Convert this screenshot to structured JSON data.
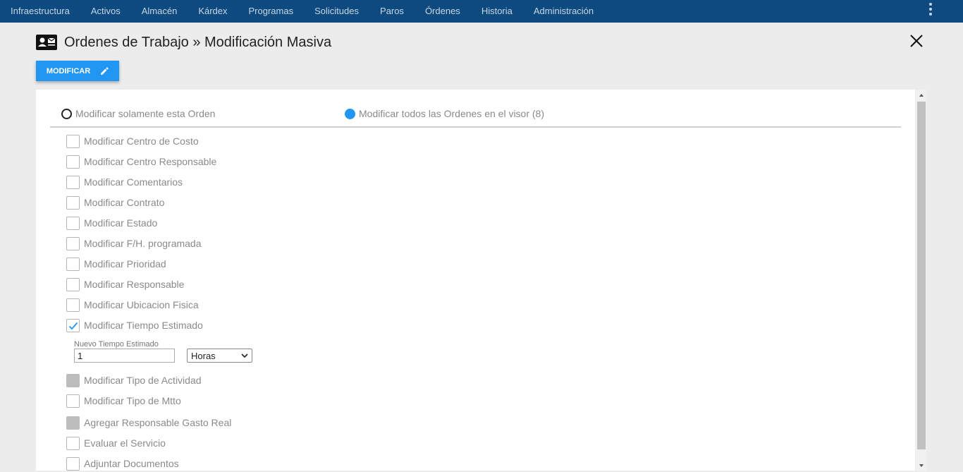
{
  "nav": {
    "items": [
      "Infraestructura",
      "Activos",
      "Almacén",
      "Kárdex",
      "Programas",
      "Solicitudes",
      "Paros",
      "Órdenes",
      "Historia",
      "Administración"
    ]
  },
  "header": {
    "title": "Ordenes de Trabajo » Modificación Masiva",
    "icon": "contact-card-icon"
  },
  "toolbar": {
    "modify_label": "MODIFICAR",
    "modify_icon": "pencil-icon"
  },
  "scope": {
    "only_this": "Modificar solamente esta Orden",
    "all_in_viewer": "Modificar todos las Ordenes en el visor (8)",
    "selected": "all_in_viewer"
  },
  "options": [
    {
      "label": "Modificar Centro de Costo",
      "state": "unchecked"
    },
    {
      "label": "Modificar Centro Responsable",
      "state": "unchecked"
    },
    {
      "label": "Modificar Comentarios",
      "state": "unchecked"
    },
    {
      "label": "Modificar Contrato",
      "state": "unchecked"
    },
    {
      "label": "Modificar Estado",
      "state": "unchecked"
    },
    {
      "label": "Modificar F/H. programada",
      "state": "unchecked"
    },
    {
      "label": "Modificar Prioridad",
      "state": "unchecked"
    },
    {
      "label": "Modificar Responsable",
      "state": "unchecked"
    },
    {
      "label": "Modificar Ubicacion Fisica",
      "state": "unchecked"
    },
    {
      "label": "Modificar Tiempo Estimado",
      "state": "checked"
    },
    {
      "label": "Modificar Tipo de Actividad",
      "state": "disabled"
    },
    {
      "label": "Modificar Tipo de Mtto",
      "state": "unchecked"
    },
    {
      "label": "Agregar Responsable Gasto Real",
      "state": "disabled"
    },
    {
      "label": "Evaluar el Servicio",
      "state": "unchecked"
    },
    {
      "label": "Adjuntar Documentos",
      "state": "unchecked"
    }
  ],
  "tiempo_estimado": {
    "label": "Nuevo Tiempo Estimado",
    "value": "1",
    "unit": "Horas"
  },
  "colors": {
    "nav_bg": "#0d4a80",
    "accent": "#2196f3",
    "label_gray": "#8a8a8a"
  }
}
